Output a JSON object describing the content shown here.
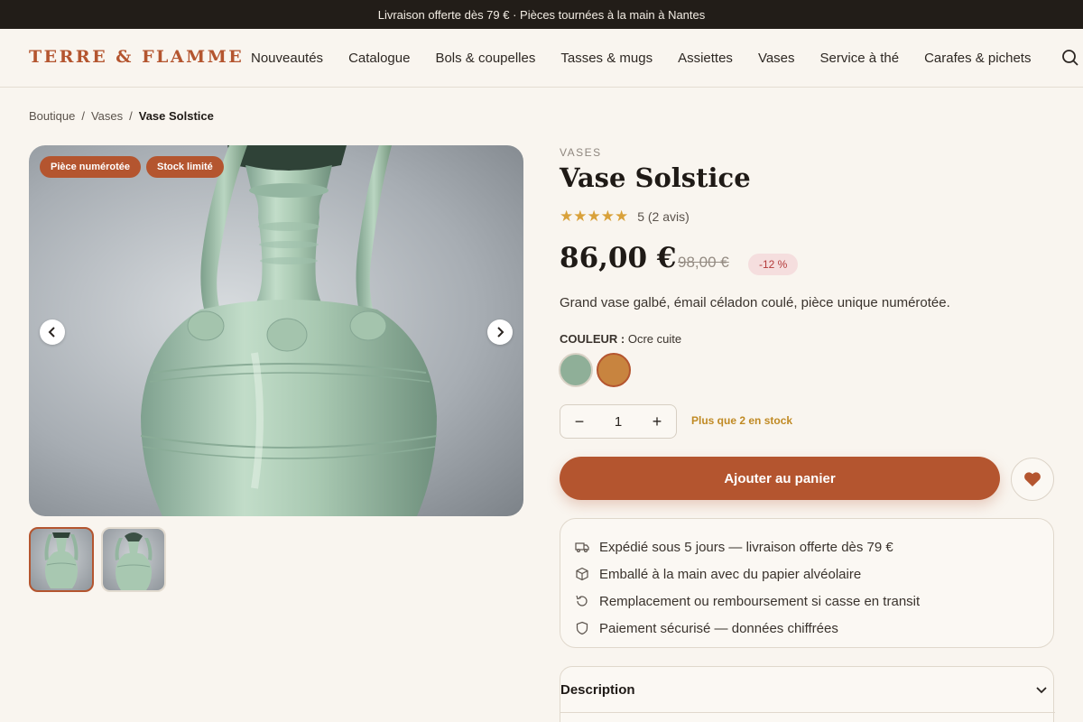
{
  "announcement": "Livraison offerte dès 79 € · Pièces tournées à la main à Nantes",
  "header": {
    "logo": "TERRE & FLAMME",
    "nav": [
      "Nouveautés",
      "Catalogue",
      "Bols & coupelles",
      "Tasses & mugs",
      "Assiettes",
      "Vases",
      "Service à thé",
      "Carafes & pichets"
    ],
    "search_icon": "search-icon"
  },
  "breadcrumb": {
    "items": [
      "Boutique",
      "Vases"
    ],
    "current": "Vase Solstice",
    "separator": "/"
  },
  "gallery": {
    "badges": [
      "Pièce numérotée",
      "Stock limité"
    ],
    "prev_icon": "chevron-left-icon",
    "next_icon": "chevron-right-icon",
    "thumbnails": 2,
    "active_thumbnail": 1
  },
  "product": {
    "category": "VASES",
    "title": "Vase Solstice",
    "rating": 5,
    "rating_text": "5 (2 avis)",
    "price": "86,00 €",
    "old_price": "98,00 €",
    "discount": "-12 %",
    "description": "Grand vase galbé, émail céladon coulé, pièce unique numérotée.",
    "color_label": "COULEUR :",
    "color_value": "Ocre cuite",
    "swatches": [
      {
        "name": "Céladon",
        "color": "#8faf98"
      },
      {
        "name": "Ocre cuite",
        "color": "#c8843f",
        "selected": true
      }
    ],
    "quantity": "1",
    "qty_minus": "−",
    "qty_plus": "+",
    "stock_note": "Plus que 2 en stock",
    "add_to_cart": "Ajouter au panier",
    "wishlist_icon": "heart-icon"
  },
  "perks": [
    {
      "icon": "truck-icon",
      "text": "Expédié sous 5 jours — livraison offerte dès 79 €"
    },
    {
      "icon": "package-icon",
      "text": "Emballé à la main avec du papier alvéolaire"
    },
    {
      "icon": "refresh-icon",
      "text": "Remplacement ou remboursement si casse en transit"
    },
    {
      "icon": "shield-icon",
      "text": "Paiement sécurisé — données chiffrées"
    }
  ],
  "accordion": {
    "title": "Description",
    "icon": "chevron-down-icon"
  },
  "colors": {
    "accent": "#b4552f",
    "topbar": "#221d18",
    "background": "#f9f5ef",
    "star": "#d9a13a",
    "stock": "#c08a24"
  }
}
